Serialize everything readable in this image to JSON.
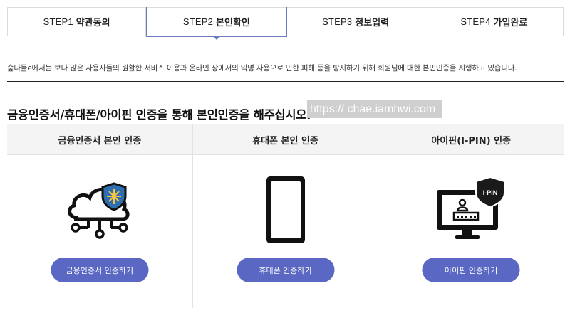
{
  "steps": [
    {
      "num": "STEP1",
      "label": "약관동의"
    },
    {
      "num": "STEP2",
      "label": "본인확인"
    },
    {
      "num": "STEP3",
      "label": "정보입력"
    },
    {
      "num": "STEP4",
      "label": "가입완료"
    }
  ],
  "active_step": 2,
  "intro_text": "숲나들e에서는 보다 많은 사용자들의 원활한 서비스 이용과 온라인 상에서의 익명 사용으로 인한 피해 등을 방지하기 위해 회원님에 대한 본인인증을 시행하고 있습니다.",
  "headline": "금융인증서/휴대폰/아이핀 인증을 통해 본인인증을 해주십시오.",
  "watermark": "https:// chae.iamhwi.com",
  "methods": [
    {
      "title": "금융인증서 본인 인증",
      "button": "금융인증서 인증하기",
      "icon": "cloud-shield-icon"
    },
    {
      "title": "휴대폰 본인 인증",
      "button": "휴대폰 인증하기",
      "icon": "smartphone-icon"
    },
    {
      "title": "아이핀(I-PIN) 인증",
      "button": "아이핀 인증하기",
      "icon": "ipin-monitor-icon",
      "badge": "I-PIN"
    }
  ],
  "colors": {
    "accent": "#5b68c3",
    "active_border": "#6a7bbf",
    "shield_blue": "#2e6db0"
  }
}
